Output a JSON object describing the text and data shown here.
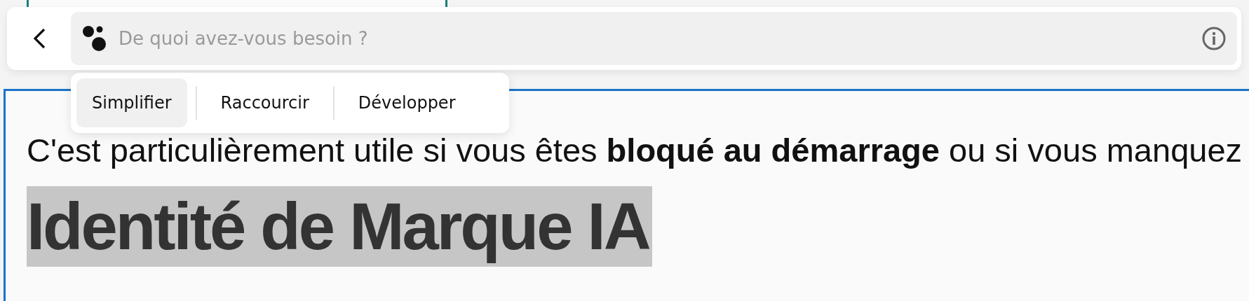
{
  "assistant_bar": {
    "placeholder": "De quoi avez-vous besoin ?"
  },
  "actions": [
    {
      "label": "Simplifier",
      "selected": true
    },
    {
      "label": "Raccourcir",
      "selected": false
    },
    {
      "label": "Développer",
      "selected": false
    }
  ],
  "document": {
    "paragraph": "C'est particulièrement utile si vous êtes **bloqué au démarrage** ou si vous manquez",
    "heading": {
      "text": "Identité de Marque IA",
      "selected": true
    }
  }
}
